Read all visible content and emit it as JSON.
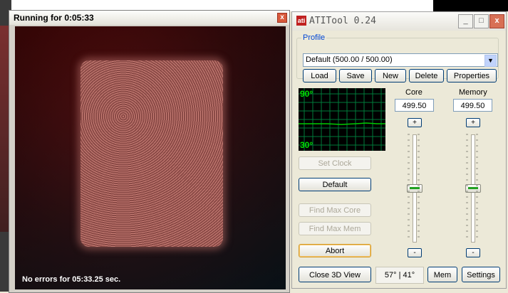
{
  "view3d": {
    "title": "Running for 0:05:33",
    "close_glyph": "x",
    "status": "No errors for 05:33.25 sec."
  },
  "atitool": {
    "title": "ATITool 0.24",
    "logo_text": "ati",
    "window_buttons": {
      "minimize": "_",
      "maximize": "□",
      "close": "x"
    },
    "profile": {
      "legend": "Profile",
      "selected": "Default (500.00 / 500.00)",
      "buttons": {
        "load": "Load",
        "save": "Save",
        "new": "New",
        "delete": "Delete",
        "properties": "Properties"
      }
    },
    "graph": {
      "top_label": "90°",
      "bottom_label": "30°",
      "line_color": "#00cc00",
      "grid_color": "#007a3a"
    },
    "core": {
      "label": "Core",
      "value": "499.50",
      "plus": "+",
      "minus": "-",
      "level": 0.5
    },
    "memory": {
      "label": "Memory",
      "value": "499.50",
      "plus": "+",
      "minus": "-",
      "level": 0.5
    },
    "buttons": {
      "set_clock": "Set Clock",
      "default": "Default",
      "find_max_core": "Find Max Core",
      "find_max_mem": "Find Max Mem",
      "abort": "Abort",
      "close_3d_view": "Close 3D View",
      "mem": "Mem",
      "settings": "Settings"
    },
    "temperature_readout": "57° | 41°"
  }
}
